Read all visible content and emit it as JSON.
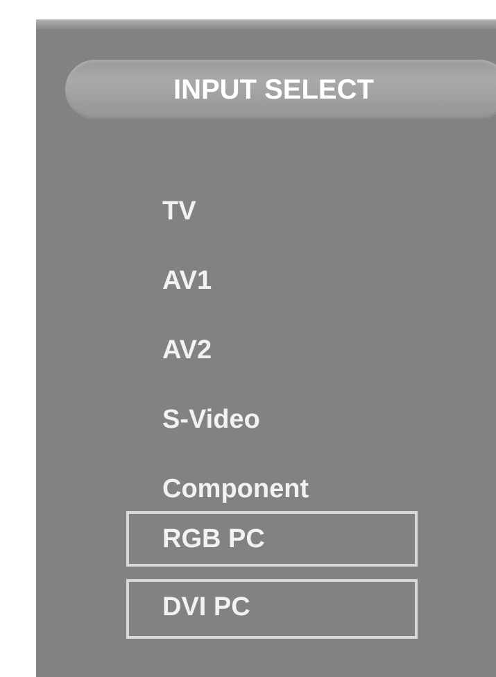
{
  "osd": {
    "title": "INPUT SELECT",
    "items": [
      {
        "label": "TV",
        "boxed": false
      },
      {
        "label": "AV1",
        "boxed": false
      },
      {
        "label": "AV2",
        "boxed": false
      },
      {
        "label": "S-Video",
        "boxed": false
      },
      {
        "label": "Component",
        "boxed": false
      },
      {
        "label": "RGB PC",
        "boxed": true
      },
      {
        "label": "DVI PC",
        "boxed": true
      }
    ]
  },
  "colors": {
    "panel_background": "#828282",
    "text": "#f2f2f2",
    "outline": "#d8d8d8"
  }
}
